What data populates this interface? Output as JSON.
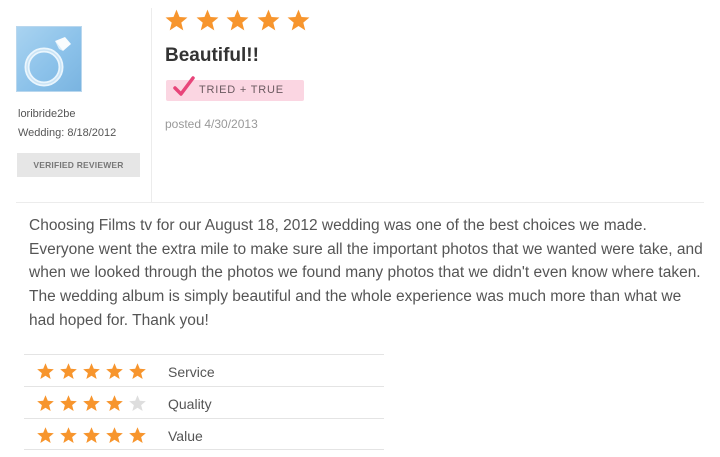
{
  "reviewer": {
    "username": "loribride2be",
    "wedding_date": "Wedding: 8/18/2012",
    "verified_label": "VERIFIED REVIEWER"
  },
  "review": {
    "rating": 5,
    "max_rating": 5,
    "title": "Beautiful!!",
    "badge_label": "TRIED + TRUE",
    "posted": "posted 4/30/2013",
    "body": "Choosing Films tv for our August 18, 2012 wedding was one of the best choices we made. Everyone went the extra mile to make sure all the important photos that we wanted were take, and when we looked through the photos we found many photos that we didn't even know where taken. The wedding album is simply beautiful and the whole experience was much more than what we had hoped for. Thank you!"
  },
  "subratings": [
    {
      "label": "Service",
      "rating": 5,
      "max": 5
    },
    {
      "label": "Quality",
      "rating": 4,
      "max": 5
    },
    {
      "label": "Value",
      "rating": 5,
      "max": 5
    }
  ],
  "colors": {
    "star_filled": "#f7952d",
    "star_empty": "#dedede",
    "badge_bg": "#fbd6e2",
    "badge_check": "#e8457a"
  },
  "icons": {
    "star": "star-icon",
    "check": "checkmark-icon",
    "avatar": "ring-avatar"
  }
}
